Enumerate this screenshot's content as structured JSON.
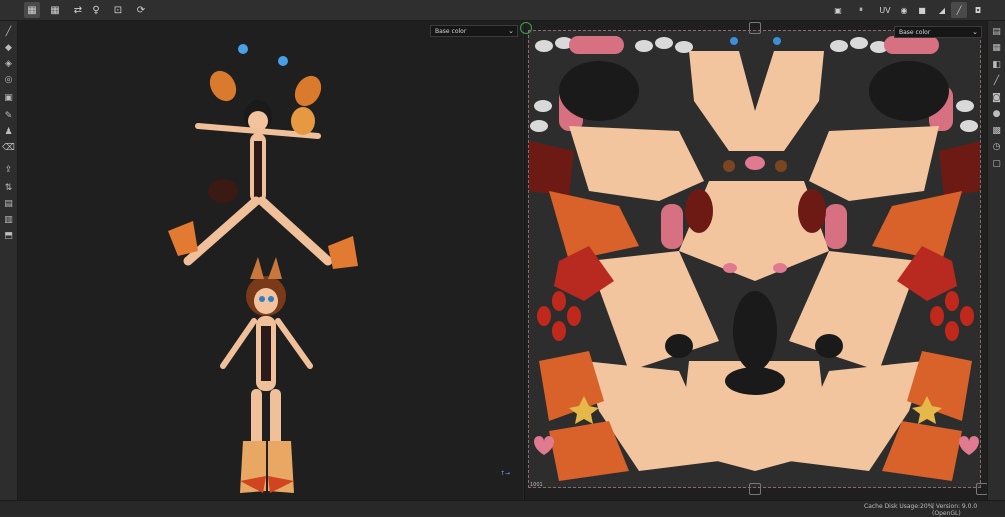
{
  "toolbar": {
    "buttons": [
      {
        "icon": "grid-1-icon",
        "glyph": "▦",
        "active": true
      },
      {
        "icon": "grid-2-icon",
        "glyph": "▦",
        "active": false
      },
      {
        "icon": "mirror-icon",
        "glyph": "⇄",
        "active": false
      },
      {
        "icon": "person-icon",
        "glyph": "♀",
        "active": false
      },
      {
        "icon": "frame-icon",
        "glyph": "⊡",
        "active": false
      },
      {
        "icon": "refresh-icon",
        "glyph": "⟳",
        "active": false
      }
    ],
    "right_buttons": [
      {
        "icon": "grid-toggle-icon",
        "glyph": "▣"
      },
      {
        "icon": "pause-icon",
        "glyph": "⏸"
      },
      {
        "icon": "uv-icon",
        "glyph": "UV"
      },
      {
        "icon": "sphere-icon",
        "glyph": "◉"
      },
      {
        "icon": "camera-video-icon",
        "glyph": "■"
      },
      {
        "icon": "droplet-icon",
        "glyph": "◢"
      },
      {
        "icon": "brush-icon",
        "glyph": "╱"
      },
      {
        "icon": "camera-icon",
        "glyph": "◘"
      }
    ]
  },
  "left_tools": [
    {
      "icon": "paint-brush-icon",
      "glyph": "╱"
    },
    {
      "icon": "eraser-icon",
      "glyph": "◆"
    },
    {
      "icon": "projection-icon",
      "glyph": "◈"
    },
    {
      "icon": "polygon-fill-icon",
      "glyph": "◎"
    },
    {
      "icon": "smudge-icon",
      "glyph": "▣"
    },
    {
      "icon": "clone-icon",
      "glyph": "✎"
    },
    {
      "icon": "stamp-icon",
      "glyph": "♟"
    },
    {
      "icon": "color-picker-icon",
      "glyph": "⌫"
    },
    {
      "icon": "export-icon",
      "glyph": "⇪"
    },
    {
      "icon": "bake-icon",
      "glyph": "⇅"
    },
    {
      "icon": "layer-icon",
      "glyph": "▤"
    },
    {
      "icon": "doc-icon",
      "glyph": "▥"
    },
    {
      "icon": "box-icon",
      "glyph": "⬒"
    }
  ],
  "right_tools": [
    {
      "icon": "texture-set-icon",
      "glyph": "▤"
    },
    {
      "icon": "properties-icon",
      "glyph": "▦"
    },
    {
      "icon": "layers-icon",
      "glyph": "◧"
    },
    {
      "icon": "brush-settings-icon",
      "glyph": "╱"
    },
    {
      "icon": "display-icon",
      "glyph": "◙"
    },
    {
      "icon": "environment-icon",
      "glyph": "●"
    },
    {
      "icon": "camera-settings-icon",
      "glyph": "▩"
    },
    {
      "icon": "history-icon",
      "glyph": "◷"
    },
    {
      "icon": "log-icon",
      "glyph": "▢"
    }
  ],
  "viewport3d": {
    "channel_dropdown": "Base color"
  },
  "viewport2d": {
    "channel_dropdown": "Base color",
    "udim_label": "1001"
  },
  "status": {
    "cache_label": "Cache Disk Usage:",
    "cache_value": "20%",
    "version": "| Version: 9.0.0 (OpenGL)"
  }
}
